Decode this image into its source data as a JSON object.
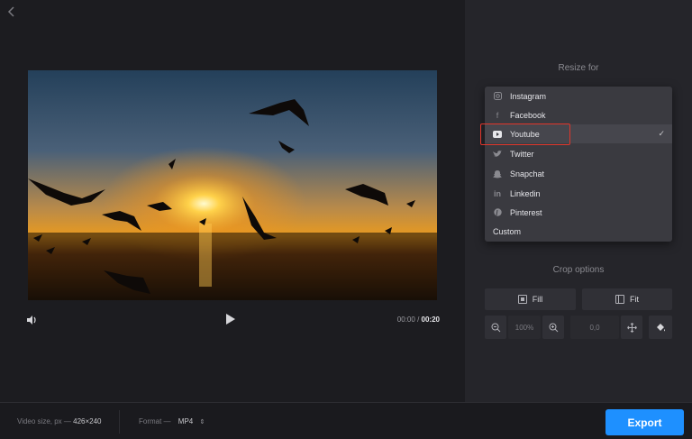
{
  "header": {
    "back_icon": "chevron-left-icon"
  },
  "player": {
    "time_current": "00:00",
    "time_separator": "/",
    "time_total": "00:20"
  },
  "resize": {
    "title": "Resize for",
    "options": [
      {
        "label": "Instagram",
        "icon": "instagram-icon"
      },
      {
        "label": "Facebook",
        "icon": "facebook-icon"
      },
      {
        "label": "Youtube",
        "icon": "youtube-icon",
        "selected": true
      },
      {
        "label": "Twitter",
        "icon": "twitter-icon"
      },
      {
        "label": "Snapchat",
        "icon": "snapchat-icon"
      },
      {
        "label": "Linkedin",
        "icon": "linkedin-icon"
      },
      {
        "label": "Pinterest",
        "icon": "pinterest-icon"
      },
      {
        "label": "Custom",
        "icon": ""
      }
    ],
    "highlight_color": "#e0362b"
  },
  "crop": {
    "title": "Crop options",
    "fill_label": "Fill",
    "fit_label": "Fit",
    "zoom_value": "100%",
    "position_value": "0,0"
  },
  "footer": {
    "video_size_label": "Video size, px —",
    "video_size_value": "426×240",
    "format_label": "Format —",
    "format_value": "MP4",
    "export_label": "Export",
    "export_color": "#1e90ff"
  }
}
